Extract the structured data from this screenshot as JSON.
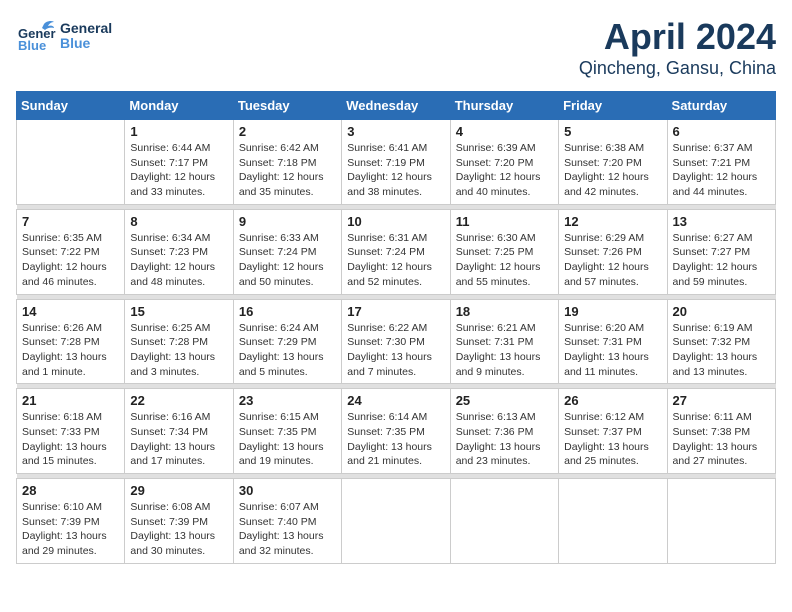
{
  "header": {
    "logo_general": "General",
    "logo_blue": "Blue",
    "title": "April 2024",
    "subtitle": "Qincheng, Gansu, China"
  },
  "weekdays": [
    "Sunday",
    "Monday",
    "Tuesday",
    "Wednesday",
    "Thursday",
    "Friday",
    "Saturday"
  ],
  "weeks": [
    [
      {
        "day": "",
        "info": ""
      },
      {
        "day": "1",
        "info": "Sunrise: 6:44 AM\nSunset: 7:17 PM\nDaylight: 12 hours\nand 33 minutes."
      },
      {
        "day": "2",
        "info": "Sunrise: 6:42 AM\nSunset: 7:18 PM\nDaylight: 12 hours\nand 35 minutes."
      },
      {
        "day": "3",
        "info": "Sunrise: 6:41 AM\nSunset: 7:19 PM\nDaylight: 12 hours\nand 38 minutes."
      },
      {
        "day": "4",
        "info": "Sunrise: 6:39 AM\nSunset: 7:20 PM\nDaylight: 12 hours\nand 40 minutes."
      },
      {
        "day": "5",
        "info": "Sunrise: 6:38 AM\nSunset: 7:20 PM\nDaylight: 12 hours\nand 42 minutes."
      },
      {
        "day": "6",
        "info": "Sunrise: 6:37 AM\nSunset: 7:21 PM\nDaylight: 12 hours\nand 44 minutes."
      }
    ],
    [
      {
        "day": "7",
        "info": "Sunrise: 6:35 AM\nSunset: 7:22 PM\nDaylight: 12 hours\nand 46 minutes."
      },
      {
        "day": "8",
        "info": "Sunrise: 6:34 AM\nSunset: 7:23 PM\nDaylight: 12 hours\nand 48 minutes."
      },
      {
        "day": "9",
        "info": "Sunrise: 6:33 AM\nSunset: 7:24 PM\nDaylight: 12 hours\nand 50 minutes."
      },
      {
        "day": "10",
        "info": "Sunrise: 6:31 AM\nSunset: 7:24 PM\nDaylight: 12 hours\nand 52 minutes."
      },
      {
        "day": "11",
        "info": "Sunrise: 6:30 AM\nSunset: 7:25 PM\nDaylight: 12 hours\nand 55 minutes."
      },
      {
        "day": "12",
        "info": "Sunrise: 6:29 AM\nSunset: 7:26 PM\nDaylight: 12 hours\nand 57 minutes."
      },
      {
        "day": "13",
        "info": "Sunrise: 6:27 AM\nSunset: 7:27 PM\nDaylight: 12 hours\nand 59 minutes."
      }
    ],
    [
      {
        "day": "14",
        "info": "Sunrise: 6:26 AM\nSunset: 7:28 PM\nDaylight: 13 hours\nand 1 minute."
      },
      {
        "day": "15",
        "info": "Sunrise: 6:25 AM\nSunset: 7:28 PM\nDaylight: 13 hours\nand 3 minutes."
      },
      {
        "day": "16",
        "info": "Sunrise: 6:24 AM\nSunset: 7:29 PM\nDaylight: 13 hours\nand 5 minutes."
      },
      {
        "day": "17",
        "info": "Sunrise: 6:22 AM\nSunset: 7:30 PM\nDaylight: 13 hours\nand 7 minutes."
      },
      {
        "day": "18",
        "info": "Sunrise: 6:21 AM\nSunset: 7:31 PM\nDaylight: 13 hours\nand 9 minutes."
      },
      {
        "day": "19",
        "info": "Sunrise: 6:20 AM\nSunset: 7:31 PM\nDaylight: 13 hours\nand 11 minutes."
      },
      {
        "day": "20",
        "info": "Sunrise: 6:19 AM\nSunset: 7:32 PM\nDaylight: 13 hours\nand 13 minutes."
      }
    ],
    [
      {
        "day": "21",
        "info": "Sunrise: 6:18 AM\nSunset: 7:33 PM\nDaylight: 13 hours\nand 15 minutes."
      },
      {
        "day": "22",
        "info": "Sunrise: 6:16 AM\nSunset: 7:34 PM\nDaylight: 13 hours\nand 17 minutes."
      },
      {
        "day": "23",
        "info": "Sunrise: 6:15 AM\nSunset: 7:35 PM\nDaylight: 13 hours\nand 19 minutes."
      },
      {
        "day": "24",
        "info": "Sunrise: 6:14 AM\nSunset: 7:35 PM\nDaylight: 13 hours\nand 21 minutes."
      },
      {
        "day": "25",
        "info": "Sunrise: 6:13 AM\nSunset: 7:36 PM\nDaylight: 13 hours\nand 23 minutes."
      },
      {
        "day": "26",
        "info": "Sunrise: 6:12 AM\nSunset: 7:37 PM\nDaylight: 13 hours\nand 25 minutes."
      },
      {
        "day": "27",
        "info": "Sunrise: 6:11 AM\nSunset: 7:38 PM\nDaylight: 13 hours\nand 27 minutes."
      }
    ],
    [
      {
        "day": "28",
        "info": "Sunrise: 6:10 AM\nSunset: 7:39 PM\nDaylight: 13 hours\nand 29 minutes."
      },
      {
        "day": "29",
        "info": "Sunrise: 6:08 AM\nSunset: 7:39 PM\nDaylight: 13 hours\nand 30 minutes."
      },
      {
        "day": "30",
        "info": "Sunrise: 6:07 AM\nSunset: 7:40 PM\nDaylight: 13 hours\nand 32 minutes."
      },
      {
        "day": "",
        "info": ""
      },
      {
        "day": "",
        "info": ""
      },
      {
        "day": "",
        "info": ""
      },
      {
        "day": "",
        "info": ""
      }
    ]
  ]
}
